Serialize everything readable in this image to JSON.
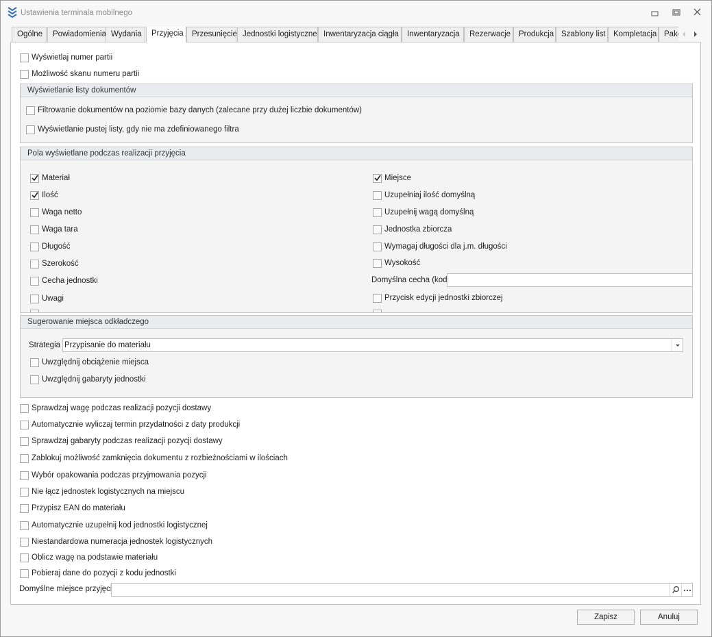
{
  "window": {
    "title": "Ustawienia terminala mobilnego",
    "controls": [
      "minimize-icon",
      "restore-icon",
      "close-icon"
    ]
  },
  "tabs": [
    {
      "label": "Ogólne"
    },
    {
      "label": "Powiadomienia"
    },
    {
      "label": "Wydania"
    },
    {
      "label": "Przyjęcia",
      "active": true
    },
    {
      "label": "Przesunięcie"
    },
    {
      "label": "Jednostki logistyczne"
    },
    {
      "label": "Inwentaryzacja ciągła"
    },
    {
      "label": "Inwentaryzacja"
    },
    {
      "label": "Rezerwacje"
    },
    {
      "label": "Produkcja"
    },
    {
      "label": "Szablony list"
    },
    {
      "label": "Kompletacja"
    },
    {
      "label": "Pako"
    }
  ],
  "top_options": [
    {
      "label": "Wyświetlaj numer partii",
      "checked": false
    },
    {
      "label": "Możliwość skanu numeru partii",
      "checked": false
    }
  ],
  "doc_list_group": {
    "title": "Wyświetlanie listy dokumentów",
    "options": [
      {
        "label": "Filtrowanie dokumentów na poziomie bazy danych (zalecane przy dużej liczbie dokumentów)",
        "checked": false
      },
      {
        "label": "Wyświetlanie pustej listy, gdy nie ma zdefiniowanego filtra",
        "checked": false
      }
    ]
  },
  "fields_group": {
    "title": "Pola wyświetlane podczas realizacji przyjęcia",
    "left": [
      {
        "label": "Materiał",
        "checked": true
      },
      {
        "label": "Ilość",
        "checked": true
      },
      {
        "label": "Waga netto",
        "checked": false
      },
      {
        "label": "Waga tara",
        "checked": false
      },
      {
        "label": "Długość",
        "checked": false
      },
      {
        "label": "Szerokość",
        "checked": false
      },
      {
        "label": "Cecha jednostki",
        "checked": false
      },
      {
        "label": "Uwagi",
        "checked": false
      }
    ],
    "right": [
      {
        "label": "Miejsce",
        "checked": true
      },
      {
        "label": "Uzupełniaj ilość domyślną",
        "checked": false
      },
      {
        "label": "Uzupełnij wagą domyślną",
        "checked": false
      },
      {
        "label": "Jednostka zbiorcza",
        "checked": false
      },
      {
        "label": "Wymagaj długości dla j.m. długości",
        "checked": false
      },
      {
        "label": "Wysokość",
        "checked": false
      },
      {
        "label": "Przycisk edycji jednostki zbiorczej",
        "checked": false
      }
    ],
    "default_feature_label": "Domyślna cecha (kod)",
    "default_feature_value": ""
  },
  "location_group": {
    "title": "Sugerowanie miejsca odkładczego",
    "strategy_label": "Strategia",
    "strategy_value": "Przypisanie do materiału",
    "options": [
      {
        "label": "Uwzględnij obciążenie miejsca",
        "checked": false
      },
      {
        "label": "Uwzględnij gabaryty jednostki",
        "checked": false
      }
    ]
  },
  "bottom_options": [
    {
      "label": "Sprawdzaj wagę podczas realizacji pozycji dostawy",
      "checked": false
    },
    {
      "label": "Automatycznie wyliczaj termin przydatności z daty produkcji",
      "checked": false
    },
    {
      "label": "Sprawdzaj gabaryty podczas realizacji pozycji dostawy",
      "checked": false
    },
    {
      "label": "Zablokuj możliwość zamknięcia dokumentu z rozbieżnościami w ilościach",
      "checked": false
    },
    {
      "label": "Wybór opakowania podczas przyjmowania pozycji",
      "checked": false
    },
    {
      "label": "Nie łącz jednostek logistycznych na miejscu",
      "checked": false
    },
    {
      "label": "Przypisz EAN do materiału",
      "checked": false
    },
    {
      "label": "Automatycznie uzupełnij kod jednostki logistycznej",
      "checked": false
    },
    {
      "label": "Niestandardowa numeracja jednostek logistycznych",
      "checked": false
    },
    {
      "label": "Oblicz wagę na podstawie materiału",
      "checked": false
    },
    {
      "label": "Pobieraj dane do pozycji z kodu jednostki",
      "checked": false
    }
  ],
  "default_location": {
    "label": "Domyślne miejsce przyjęcia",
    "value": ""
  },
  "buttons": {
    "save": "Zapisz",
    "cancel": "Anuluj"
  }
}
